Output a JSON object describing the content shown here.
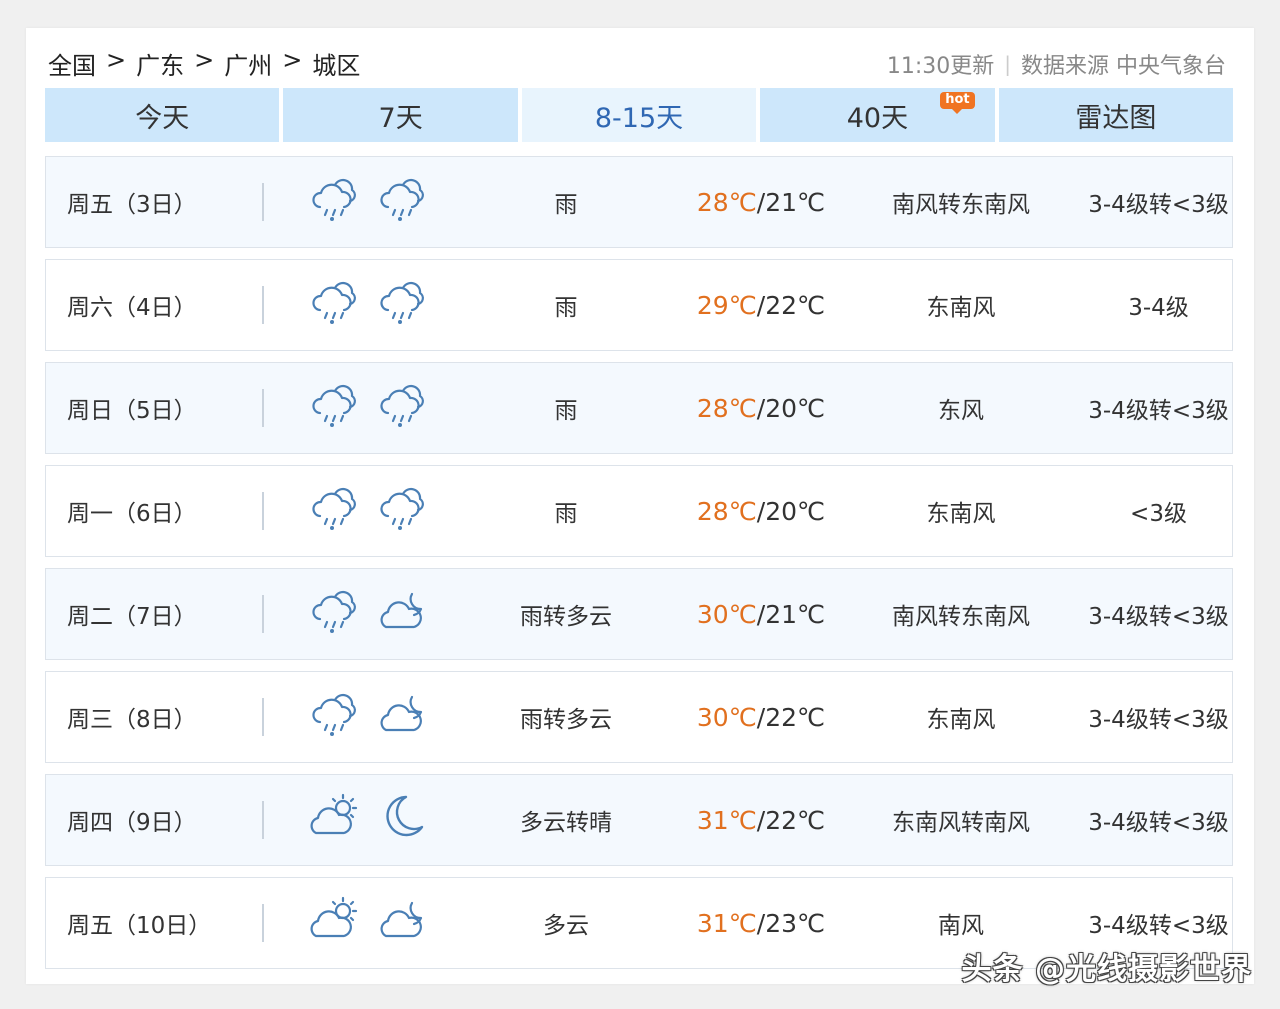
{
  "breadcrumb": [
    "全国",
    "广东",
    "广州",
    "城区"
  ],
  "breadcrumb_sep": ">",
  "update_time": "11:30更新",
  "source_sep": "|",
  "source": "数据来源 中央气象台",
  "tabs": [
    {
      "label": "今天"
    },
    {
      "label": "7天"
    },
    {
      "label": "8-15天",
      "active": true
    },
    {
      "label": "40天",
      "badge": "hot"
    },
    {
      "label": "雷达图"
    }
  ],
  "colors": {
    "accent": "#2f67b3",
    "hi_temp": "#e1701f",
    "tab_bg": "#cde7fb",
    "hot_badge": "#f07422"
  },
  "days": [
    {
      "day": "周五（3日）",
      "icons": [
        "rain-cloud-icon",
        "rain-cloud-icon"
      ],
      "desc": "雨",
      "hi": "28℃",
      "lo": "/21℃",
      "wind": "南风转东南风",
      "level": "3-4级转<3级"
    },
    {
      "day": "周六（4日）",
      "icons": [
        "rain-cloud-icon",
        "rain-cloud-icon"
      ],
      "desc": "雨",
      "hi": "29℃",
      "lo": "/22℃",
      "wind": "东南风",
      "level": "3-4级"
    },
    {
      "day": "周日（5日）",
      "icons": [
        "rain-cloud-icon",
        "rain-cloud-icon"
      ],
      "desc": "雨",
      "hi": "28℃",
      "lo": "/20℃",
      "wind": "东风",
      "level": "3-4级转<3级"
    },
    {
      "day": "周一（6日）",
      "icons": [
        "rain-cloud-icon",
        "rain-cloud-icon"
      ],
      "desc": "雨",
      "hi": "28℃",
      "lo": "/20℃",
      "wind": "东南风",
      "level": "<3级"
    },
    {
      "day": "周二（7日）",
      "icons": [
        "rain-cloud-icon",
        "cloudy-night-icon"
      ],
      "desc": "雨转多云",
      "hi": "30℃",
      "lo": "/21℃",
      "wind": "南风转东南风",
      "level": "3-4级转<3级"
    },
    {
      "day": "周三（8日）",
      "icons": [
        "rain-cloud-icon",
        "cloudy-night-icon"
      ],
      "desc": "雨转多云",
      "hi": "30℃",
      "lo": "/22℃",
      "wind": "东南风",
      "level": "3-4级转<3级"
    },
    {
      "day": "周四（9日）",
      "icons": [
        "partly-cloudy-day-icon",
        "moon-icon"
      ],
      "desc": "多云转晴",
      "hi": "31℃",
      "lo": "/22℃",
      "wind": "东南风转南风",
      "level": "3-4级转<3级"
    },
    {
      "day": "周五（10日）",
      "icons": [
        "partly-cloudy-day-icon",
        "cloudy-night-icon"
      ],
      "desc": "多云",
      "hi": "31℃",
      "lo": "/23℃",
      "wind": "南风",
      "level": "3-4级转<3级"
    }
  ],
  "watermark": "头条 @光线摄影世界"
}
